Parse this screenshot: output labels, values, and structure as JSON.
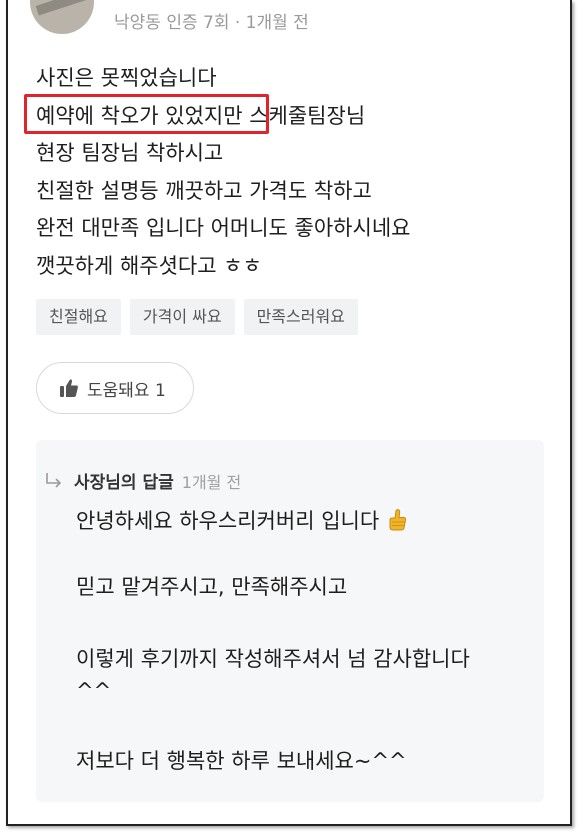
{
  "review": {
    "meta": "낙양동 인증 7회 · 1개월 전",
    "lines": [
      "사진은 못찍었습니다",
      "예약에 착오가 있었지만 스케줄팀장님",
      "현장 팀장님 착하시고",
      "친절한 설명등 깨끗하고 가격도 착하고",
      "완전 대만족 입니다 어머니도 좋아하시네요",
      "깻끗하게 해주셧다고 ㅎㅎ"
    ],
    "highlighted_phrase": "예약에 착오가 있었지만"
  },
  "tags": [
    "친절해요",
    "가격이 싸요",
    "만족스러워요"
  ],
  "helpful_button": {
    "label": "도움돼요 1"
  },
  "reply": {
    "author": "사장님의 답글",
    "time": "1개월 전",
    "paragraphs": [
      "안녕하세요 하우스리커버리 입니다",
      "믿고 맡겨주시고, 만족해주시고",
      "이렇게 후기까지 작성해주셔서 넘 감사합니다",
      "^^",
      "저보다 더 행복한 하루 보내세요~^^"
    ]
  },
  "colors": {
    "highlight_border": "#e0242b",
    "tag_bg": "#f1f2f3",
    "reply_bg": "#f6f7f8"
  },
  "icons": [
    "thumbs-up-icon",
    "reply-arrow-icon",
    "thumbs-up-emoji"
  ]
}
